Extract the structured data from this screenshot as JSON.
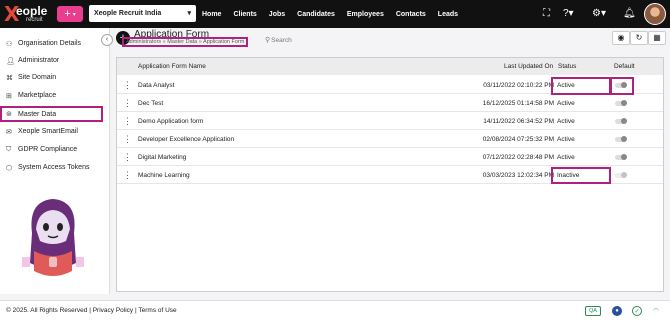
{
  "brand": {
    "logo_word": "eople",
    "logo_x": "X",
    "logo_sub": "recruit"
  },
  "topbar": {
    "add_icon": "plus-icon",
    "company": "Xeople Recruit India",
    "nav": [
      "Home",
      "Clients",
      "Jobs",
      "Candidates",
      "Employees",
      "Contacts",
      "Leads"
    ],
    "icons": [
      "expand-icon",
      "help-icon",
      "gear-icon",
      "bell-icon"
    ]
  },
  "sidebar": {
    "items": [
      {
        "label": "Organisation Details",
        "icon": "org-icon"
      },
      {
        "label": "Administrator",
        "icon": "user-icon"
      },
      {
        "label": "Site Domain",
        "icon": "domain-icon"
      },
      {
        "label": "Marketplace",
        "icon": "market-icon"
      },
      {
        "label": "Master Data",
        "icon": "data-icon"
      },
      {
        "label": "Xeople SmartEmail",
        "icon": "mail-icon"
      },
      {
        "label": "GDPR Compliance",
        "icon": "shield-icon"
      },
      {
        "label": "System Access Tokens",
        "icon": "token-icon"
      }
    ],
    "active_index": 4
  },
  "main": {
    "title": "Application Form",
    "breadcrumb": "Administrators » Master Data » Application Form",
    "search_placeholder": "Search",
    "toolbar_icons": [
      "eye-icon",
      "refresh-icon",
      "grid-icon"
    ],
    "table": {
      "headers": {
        "name": "Application Form Name",
        "updated": "Last Updated On",
        "status": "Status",
        "default": "Default"
      },
      "rows": [
        {
          "name": "Data Analyst",
          "updated": "03/11/2022 02:10:22 PM",
          "status": "Active"
        },
        {
          "name": "Dec Test",
          "updated": "16/12/2025 01:14:58 PM",
          "status": "Active"
        },
        {
          "name": "Demo Application form",
          "updated": "14/11/2022 06:34:52 PM",
          "status": "Active"
        },
        {
          "name": "Developer Excellence Application",
          "updated": "02/08/2024 07:25:32 PM",
          "status": "Active"
        },
        {
          "name": "Digital Marketing",
          "updated": "07/12/2022 02:28:48 PM",
          "status": "Active"
        },
        {
          "name": "Machine Learning",
          "updated": "03/03/2023 12:02:34 PM",
          "status": "Inactive"
        }
      ]
    }
  },
  "footer": {
    "copyright": "© 2025. All Rights Reserved",
    "privacy": "Privacy Policy",
    "terms": "Terms of Use",
    "qa": "QA"
  },
  "colors": {
    "accent": "#b0207e",
    "pink_button": "#e93d8f",
    "topbar": "#111111"
  }
}
